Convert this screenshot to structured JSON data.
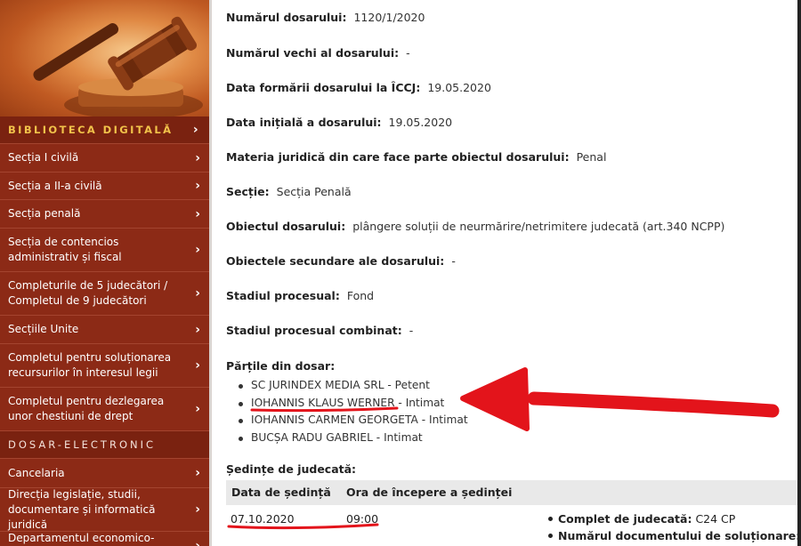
{
  "sidebar": {
    "items": [
      {
        "label": "BIBLIOTECA DIGITALĂ",
        "type": "header"
      },
      {
        "label": "Secția I civilă"
      },
      {
        "label": "Secția a II-a civilă"
      },
      {
        "label": "Secția penală"
      },
      {
        "label": "Secția de contencios administrativ și fiscal"
      },
      {
        "label": "Completurile de 5 judecători / Completul de 9 judecători"
      },
      {
        "label": "Secțiile Unite"
      },
      {
        "label": "Completul pentru soluționarea recursurilor în interesul legii"
      },
      {
        "label": "Completul pentru dezlegarea unor chestiuni de drept"
      },
      {
        "label": "DOSAR-ELECTRONIC",
        "type": "header-plain"
      },
      {
        "label": "Cancelaria"
      },
      {
        "label": "Direcția legislație, studii, documentare și informatică juridică"
      },
      {
        "label": "Departamentul economico-financiar"
      }
    ]
  },
  "case": {
    "numar_label": "Numărul dosarului:",
    "numar_value": "1120/1/2020",
    "numar_vechi_label": "Numărul vechi al dosarului:",
    "numar_vechi_value": "-",
    "data_formarii_label": "Data formării dosarului la ÎCCJ:",
    "data_formarii_value": "19.05.2020",
    "data_initiala_label": "Data inițială a dosarului:",
    "data_initiala_value": "19.05.2020",
    "materia_label": "Materia juridică din care face parte obiectul dosarului:",
    "materia_value": "Penal",
    "sectie_label": "Secție:",
    "sectie_value": "Secția Penală",
    "obiect_label": "Obiectul dosarului:",
    "obiect_value": "plângere soluții de neurmărire/netrimitere judecată (art.340 NCPP)",
    "obiecte_sec_label": "Obiectele secundare ale dosarului:",
    "obiecte_sec_value": "-",
    "stadiu_label": "Stadiul procesual:",
    "stadiu_value": "Fond",
    "stadiu_comb_label": "Stadiul procesual combinat:",
    "stadiu_comb_value": "-"
  },
  "parties": {
    "title": "Părțile din dosar:",
    "items": [
      {
        "name": "SC JURINDEX MEDIA SRL",
        "role": " - Petent"
      },
      {
        "name": "IOHANNIS KLAUS WERNER",
        "role": " - Intimat"
      },
      {
        "name": "IOHANNIS CARMEN GEORGETA",
        "role": " - Intimat"
      },
      {
        "name": "BUCȘA RADU GABRIEL",
        "role": " - Intimat"
      }
    ]
  },
  "hearings": {
    "title": "Ședințe de judecată:",
    "col_date": "Data de ședință",
    "col_time": "Ora de începere a ședinței",
    "rows": [
      {
        "date": "07.10.2020",
        "time": "09:00",
        "complet_label": "Complet de judecată:",
        "complet_value": "C24 CP",
        "nr_doc_label": "Numărul documentului de soluționare:",
        "nr_doc_value": "-"
      }
    ]
  },
  "colors": {
    "sidebar_bg": "#8c2a16",
    "sidebar_header_text": "#f1c24a",
    "annotation_red": "#e3141b"
  },
  "icons": [
    "gavel-image",
    "chevron-right-icon",
    "red-arrow-annotation"
  ]
}
